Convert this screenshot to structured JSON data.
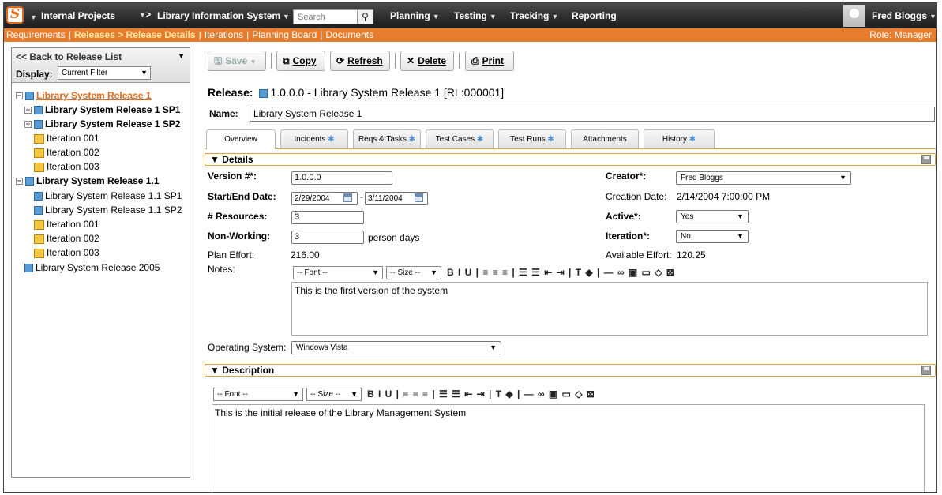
{
  "topnav": {
    "project": "Internal Projects",
    "arrow": ">",
    "product": "Library Information System",
    "search_placeholder": "Search",
    "menus": [
      "Planning",
      "Testing",
      "Tracking",
      "Reporting"
    ],
    "user": "Fred Bloggs"
  },
  "subnav": {
    "items": [
      "Requirements",
      "Releases > Release Details",
      "Iterations",
      "Planning Board",
      "Documents"
    ],
    "role": "Role: Manager"
  },
  "sidebar": {
    "back": "<< Back to Release List",
    "display_label": "Display:",
    "display_value": "Current Filter",
    "tree": [
      {
        "label": "Library System Release 1",
        "type": "release",
        "selected": true
      },
      {
        "label": "Library System Release 1 SP1",
        "type": "release"
      },
      {
        "label": "Library System Release 1 SP2",
        "type": "release"
      },
      {
        "label": "Iteration 001",
        "type": "iteration"
      },
      {
        "label": "Iteration 002",
        "type": "iteration"
      },
      {
        "label": "Iteration 003",
        "type": "iteration"
      },
      {
        "label": "Library System Release 1.1",
        "type": "release"
      },
      {
        "label": "Library System Release 1.1 SP1",
        "type": "release"
      },
      {
        "label": "Library System Release 1.1 SP2",
        "type": "release"
      },
      {
        "label": "Iteration 001",
        "type": "iteration"
      },
      {
        "label": "Iteration 002",
        "type": "iteration"
      },
      {
        "label": "Iteration 003",
        "type": "iteration"
      },
      {
        "label": "Library System Release 2005",
        "type": "release"
      }
    ]
  },
  "toolbar": {
    "save": "Save",
    "copy": "Copy",
    "refresh": "Refresh",
    "delete": "Delete",
    "print": "Print"
  },
  "release": {
    "heading_label": "Release:",
    "heading_value": "1.0.0.0 - Library System Release 1 [RL:000001]",
    "name_label": "Name:",
    "name_value": "Library System Release 1"
  },
  "tabs": [
    "Overview",
    "Incidents",
    "Reqs & Tasks",
    "Test Cases",
    "Test Runs",
    "Attachments",
    "History"
  ],
  "details": {
    "header": "Details",
    "version_label": "Version #*:",
    "version_value": "1.0.0.0",
    "dates_label": "Start/End Date:",
    "start_date": "2/29/2004",
    "end_date": "3/11/2004",
    "dash": "-",
    "resources_label": "# Resources:",
    "resources_value": "3",
    "nonworking_label": "Non-Working:",
    "nonworking_value": "3",
    "nonworking_unit": "person days",
    "plan_effort_label": "Plan Effort:",
    "plan_effort_value": "216.00",
    "notes_label": "Notes:",
    "notes_text": "This is the first version of the system",
    "creator_label": "Creator*:",
    "creator_value": "Fred Bloggs",
    "creation_date_label": "Creation Date:",
    "creation_date_value": "2/14/2004 7:00:00 PM",
    "active_label": "Active*:",
    "active_value": "Yes",
    "iteration_label": "Iteration*:",
    "iteration_value": "No",
    "available_effort_label": "Available Effort:",
    "available_effort_value": "120.25",
    "os_label": "Operating System:",
    "os_value": "Windows Vista"
  },
  "editor": {
    "font": "-- Font --",
    "size": "-- Size --",
    "tools": "B I U | ≡ ≡ ≡ | ☰ ☰ ⇤ ⇥ | T ◆ | — ∞ ▣ ▭ ◇ ⊠"
  },
  "description": {
    "header": "Description",
    "text": "This is the initial release of the Library Management System"
  }
}
